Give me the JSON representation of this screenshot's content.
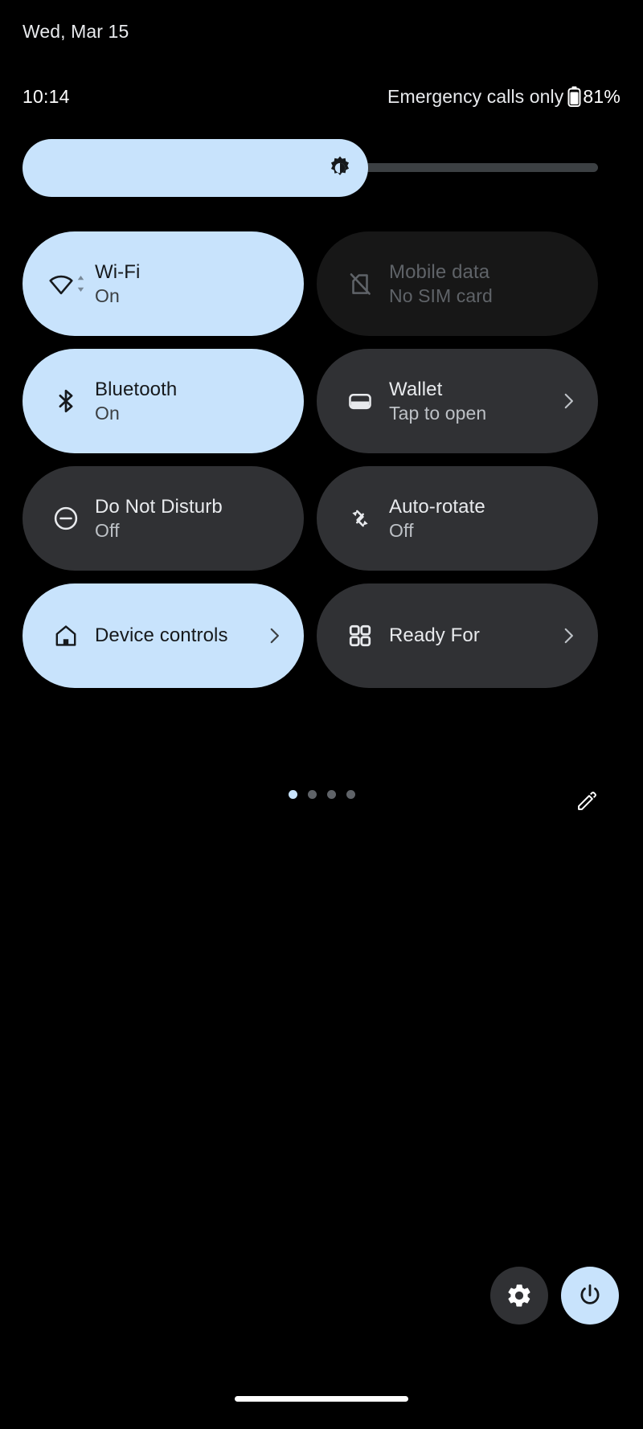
{
  "status": {
    "date": "Wed, Mar 15",
    "clock": "10:14",
    "carrier": "Emergency calls only",
    "battery_percent": "81%",
    "battery_icon": "battery-icon",
    "battery_level": 81
  },
  "brightness": {
    "name": "brightness-slider",
    "icon": "brightness-icon",
    "fill_percent": 60,
    "active_color": "#c8e3fc",
    "track_color": "#3c4043"
  },
  "tiles": [
    {
      "id": "wifi",
      "label": "Wi-Fi",
      "sub": "On",
      "icon": "wifi-icon",
      "state": "active",
      "chevron": false
    },
    {
      "id": "mobile-data",
      "label": "Mobile data",
      "sub": "No SIM card",
      "icon": "sim-off-icon",
      "state": "disabled",
      "chevron": false
    },
    {
      "id": "bluetooth",
      "label": "Bluetooth",
      "sub": "On",
      "icon": "bluetooth-icon",
      "state": "active",
      "chevron": false
    },
    {
      "id": "wallet",
      "label": "Wallet",
      "sub": "Tap to open",
      "icon": "wallet-icon",
      "state": "inactive",
      "chevron": true
    },
    {
      "id": "do-not-disturb",
      "label": "Do Not Disturb",
      "sub": "Off",
      "icon": "do-not-disturb-icon",
      "state": "inactive",
      "chevron": false
    },
    {
      "id": "auto-rotate",
      "label": "Auto-rotate",
      "sub": "Off",
      "icon": "auto-rotate-icon",
      "state": "inactive",
      "chevron": false
    },
    {
      "id": "device-controls",
      "label": "Device controls",
      "sub": "",
      "icon": "home-icon",
      "state": "active",
      "chevron": true
    },
    {
      "id": "ready-for",
      "label": "Ready For",
      "sub": "",
      "icon": "grid-apps-icon",
      "state": "inactive",
      "chevron": true
    }
  ],
  "pager": {
    "total_pages": 4,
    "current_page": 1,
    "edit_icon": "pencil-edit-icon"
  },
  "bottom": {
    "settings_icon": "gear-icon",
    "power_icon": "power-icon",
    "home_bar": "home-gesture-bar"
  },
  "colors": {
    "accent": "#c8e3fc",
    "tile_inactive": "#303134",
    "tile_disabled": "#171717",
    "background": "#000000"
  }
}
